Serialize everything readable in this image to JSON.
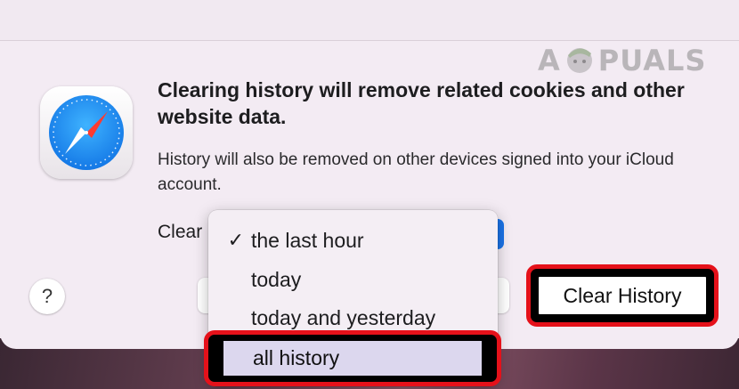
{
  "dialog": {
    "headline": "Clearing history will remove related cookies and other website data.",
    "subtext": "History will also be removed on other devices signed into your iCloud account.",
    "clear_label": "Clear",
    "help_label": "?",
    "clear_history_label": "Clear History"
  },
  "menu": {
    "items": [
      {
        "label": "the last hour",
        "checked": "✓"
      },
      {
        "label": "today",
        "checked": ""
      },
      {
        "label": "today and yesterday",
        "checked": ""
      },
      {
        "label": "all history",
        "checked": ""
      }
    ],
    "selected": "the last hour"
  },
  "watermark": {
    "left": "A",
    "right": "PUALS"
  },
  "icons": {
    "app": "safari-compass-icon",
    "check": "checkmark-icon"
  },
  "colors": {
    "annotation": "#e5111a",
    "accent": "#1a73e8",
    "sheet": "#f3ebf3"
  }
}
